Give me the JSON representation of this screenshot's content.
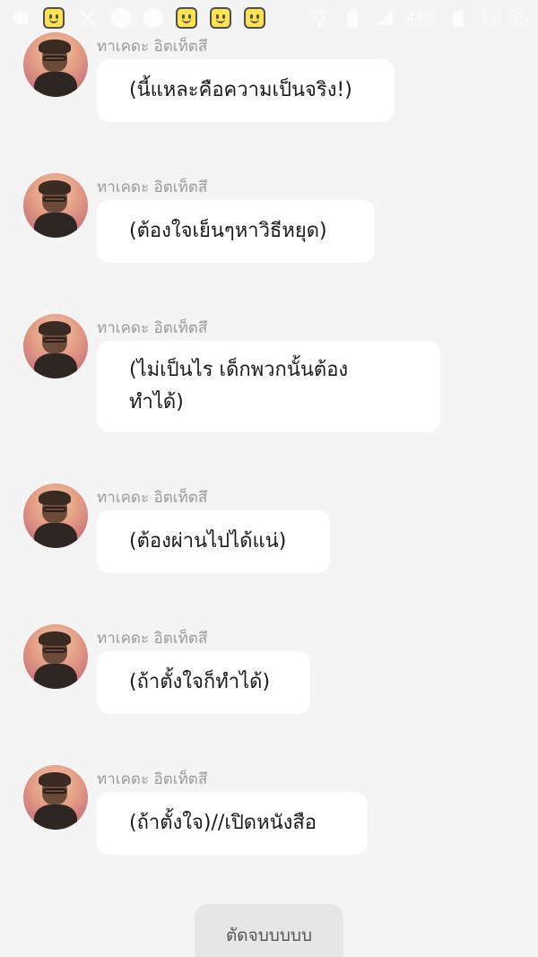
{
  "status_bar": {
    "time": "18:55",
    "battery_percent": "44%",
    "icons": [
      "back-icon",
      "emoji-icon",
      "no-wifi-icon",
      "facebook-icon",
      "facebook-icon",
      "emoji-icon",
      "emoji-icon",
      "emoji-icon",
      "wifi-icon",
      "battery-icon",
      "signal-icon"
    ]
  },
  "chat": {
    "messages": [
      {
        "sender": "ทาเคดะ อิตเท็ตสึ",
        "text": "(นี้แหละคือความเป็นจริง!)"
      },
      {
        "sender": "ทาเคดะ อิตเท็ตสึ",
        "text": "(ต้องใจเย็นๆหาวิธีหยุด)"
      },
      {
        "sender": "ทาเคดะ อิตเท็ตสึ",
        "text": "(ไม่เป็นไร เด็กพวกนั้นต้อง\nทำได้)"
      },
      {
        "sender": "ทาเคดะ อิตเท็ตสึ",
        "text": "(ต้องผ่านไปได้แน่)"
      },
      {
        "sender": "ทาเคดะ อิตเท็ตสึ",
        "text": "(ถ้าตั้งใจก็ทำได้)"
      },
      {
        "sender": "ทาเคดะ อิตเท็ตสึ",
        "text": "(ถ้าตั้งใจ)//เปิดหนังสือ"
      }
    ]
  },
  "bottom_button": {
    "label": "ตัดจบบบบบ"
  },
  "colors": {
    "background": "#f4f4f4",
    "bubble": "#ffffff",
    "sender_name": "#9a9a9a",
    "button": "#e6e6e6"
  }
}
